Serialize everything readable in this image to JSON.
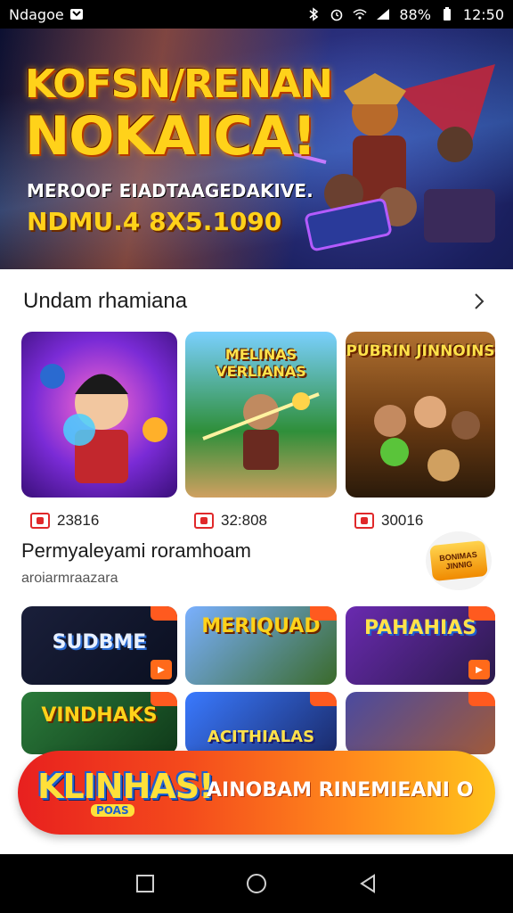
{
  "status_bar": {
    "app_name": "Ndagoe",
    "battery": "88%",
    "time": "12:50"
  },
  "hero": {
    "title_line1": "KOFSN/RENAN",
    "title_line2": "NOKAICA!",
    "subtitle1": "MEROOF EIADTAAGEDAKIVE.",
    "subtitle2": "NDMU.4 8X5.1090"
  },
  "section1": {
    "title": "Undam rhamiana",
    "games": [
      {
        "art_label": "",
        "count": "23816",
        "accent": "#7a2bd6"
      },
      {
        "art_label": "MELINAS VERLIANAS",
        "count": "32:808",
        "accent": "#2f8f3a"
      },
      {
        "art_label": "PUBRIN JINNOINS",
        "count": "30016",
        "accent": "#6a3a12"
      }
    ]
  },
  "section2": {
    "title": "Permyaleyami roramhoam",
    "subtitle": "aroiarmraazara",
    "badge_text": "BONIMAS JINNIG",
    "tiles": [
      {
        "label": "SUDBME"
      },
      {
        "label": "MERIQUAD"
      },
      {
        "label": "PAHAHIAS"
      },
      {
        "label": "VINDHAKS"
      },
      {
        "label": "ACITHIALAS"
      },
      {
        "label": ""
      }
    ]
  },
  "cta": {
    "logo_big": "KLINHAS!",
    "logo_small": "POAS",
    "text": "AINOBAM RINEMIEANI O"
  },
  "colors": {
    "accent": "#ff6a1a",
    "cta_start": "#e8201f",
    "cta_end": "#ffc21c",
    "title_yellow": "#ffd21a"
  }
}
